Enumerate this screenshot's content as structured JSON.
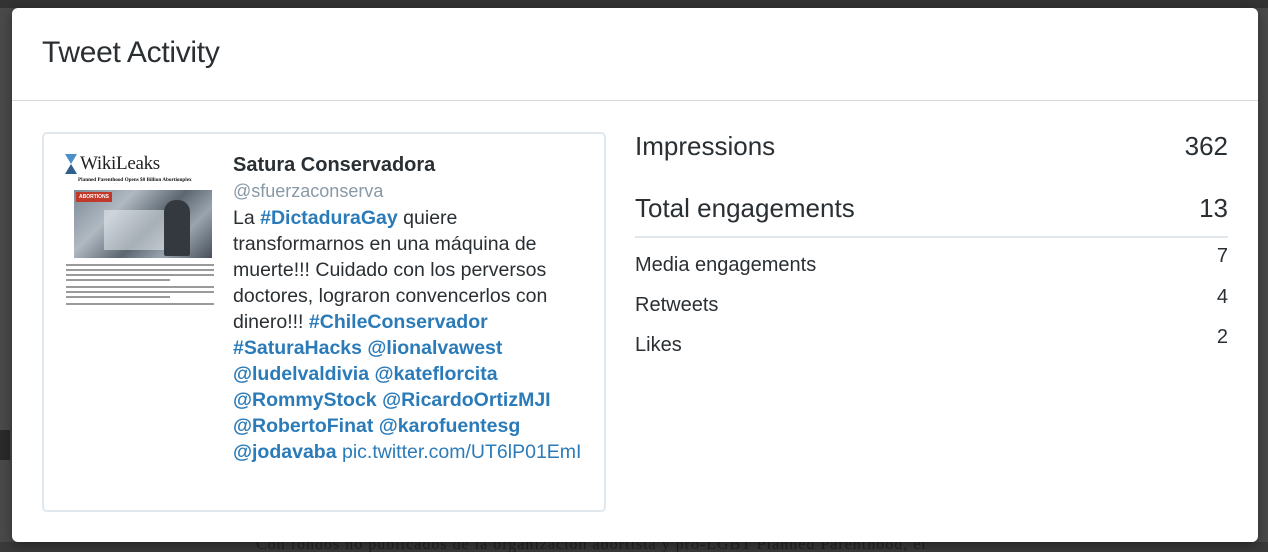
{
  "modal": {
    "title": "Tweet Activity"
  },
  "tweet": {
    "name": "Satura Conservadora",
    "handle": "@sfuerzaconserva",
    "text_prefix": "La ",
    "hashtag_1": "#DictaduraGay",
    "text_body": " quiere transformarnos en una máquina de muerte!!! Cuidado con los perversos doctores, lograron convencerlos con dinero!!!",
    "hashtag_2": "#ChileConservador",
    "hashtag_3": "#SaturaHacks",
    "mention_1": "@lionalvawest",
    "mention_2": "@ludelvaldivia",
    "mention_3": "@kateflorcita",
    "mention_4": "@RommyStock",
    "mention_5": "@RicardoOrtizMJI",
    "mention_6": "@RobertoFinat",
    "mention_7": "@karofuentesg",
    "mention_8": "@jodavaba",
    "pic_link": "pic.twitter.com/UT6lP01EmI",
    "thumbnail": {
      "logo_text": "WikiLeaks",
      "headline": "Planned Parenthood Opens $8 Billion Abortionplex",
      "badge": "ABORTIONS"
    }
  },
  "metrics": {
    "impressions_label": "Impressions",
    "impressions_value": "362",
    "engagements_label": "Total engagements",
    "engagements_value": "13",
    "breakdown": [
      {
        "label": "Media engagements",
        "value": "7"
      },
      {
        "label": "Retweets",
        "value": "4"
      },
      {
        "label": "Likes",
        "value": "2"
      }
    ]
  },
  "background": {
    "body_text": "Con fondos no publicados de la organización abortista y pro-LGBT Planned Parenthood, el"
  },
  "colors": {
    "link": "#2b7bb9",
    "handle": "#8899a6",
    "text": "#292f33",
    "border": "#e1e8ed"
  }
}
